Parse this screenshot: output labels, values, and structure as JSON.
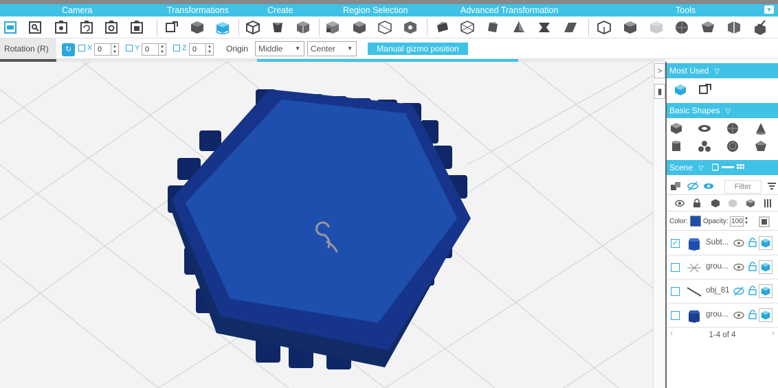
{
  "categories": [
    "Camera",
    "Transformations",
    "Create",
    "Region Selection",
    "Advanced Transformation",
    "Tools"
  ],
  "options": {
    "mode_label": "Rotation (R)",
    "x_label": "X",
    "x_value": "0",
    "y_label": "Y",
    "y_value": "0",
    "z_label": "Z",
    "z_value": "0",
    "origin_label": "Origin",
    "origin_select": "Middle",
    "align_select": "Center",
    "gizmo_button": "Manual gizmo position"
  },
  "panel": {
    "most_used": "Most Used",
    "basic_shapes": "Basic Shapes",
    "scene": "Scene",
    "filter": "Filter",
    "color_label": "Color:",
    "opacity_label": "Opacity:",
    "opacity_value": "100",
    "rows": [
      {
        "name": "Subt...",
        "checked": true
      },
      {
        "name": "grou...",
        "checked": false
      },
      {
        "name": "obj_81",
        "checked": false
      },
      {
        "name": "grou...",
        "checked": false
      }
    ],
    "pager": "1-4 of 4"
  },
  "colors": {
    "accent": "#3fc2e6",
    "object": "#1e4fae",
    "object_dark": "#112b66"
  }
}
